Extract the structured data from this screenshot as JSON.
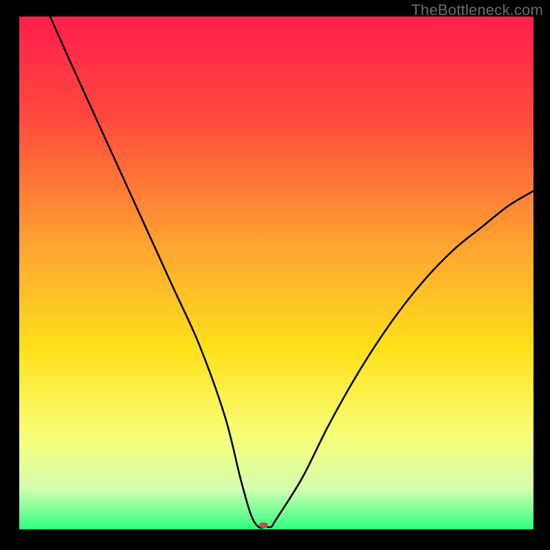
{
  "watermark": "TheBottleneck.com",
  "chart_data": {
    "type": "line",
    "title": "",
    "xlabel": "",
    "ylabel": "",
    "xlim": [
      0,
      100
    ],
    "ylim": [
      0,
      100
    ],
    "gradient_stops": [
      {
        "offset": 0,
        "color": "#ff1e4c"
      },
      {
        "offset": 20,
        "color": "#ff4a3c"
      },
      {
        "offset": 45,
        "color": "#ffa531"
      },
      {
        "offset": 65,
        "color": "#ffe11a"
      },
      {
        "offset": 82,
        "color": "#f8ff7a"
      },
      {
        "offset": 92,
        "color": "#d4ffb0"
      },
      {
        "offset": 100,
        "color": "#2fff82"
      }
    ],
    "series": [
      {
        "name": "bottleneck-curve",
        "x": [
          6,
          10,
          15,
          20,
          25,
          30,
          35,
          40,
          43,
          45,
          46.5,
          48,
          49,
          50,
          55,
          60,
          65,
          70,
          75,
          80,
          85,
          90,
          95,
          100
        ],
        "y": [
          100,
          91,
          80,
          69,
          58,
          47,
          36,
          22,
          10,
          3,
          0.5,
          0.5,
          0.5,
          2,
          10,
          20,
          29,
          37,
          44,
          50,
          55,
          59,
          63,
          66
        ]
      }
    ],
    "marker": {
      "x": 47.5,
      "y": 0.8,
      "color": "#c74b44"
    }
  }
}
